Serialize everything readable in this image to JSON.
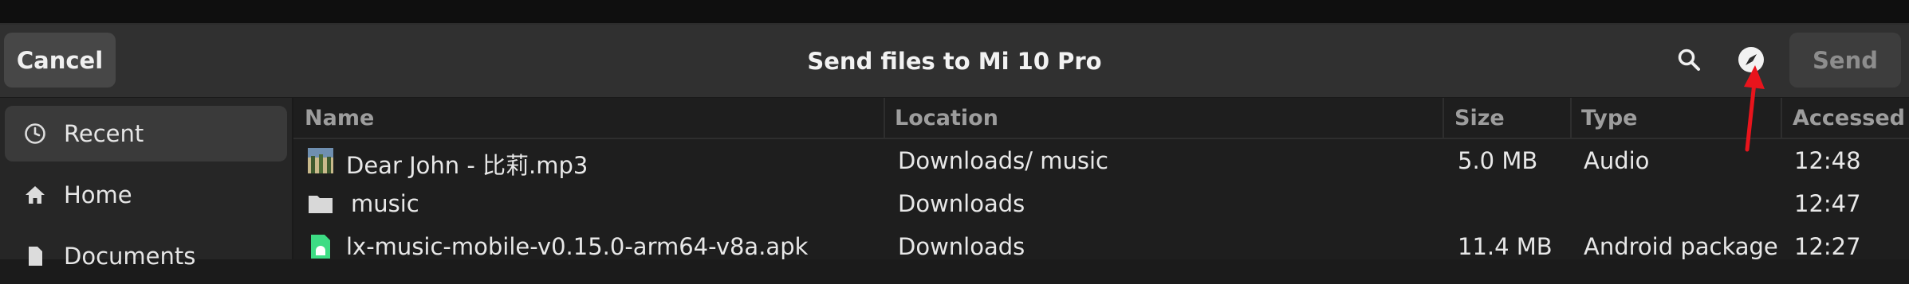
{
  "header": {
    "cancel_label": "Cancel",
    "title": "Send files to Mi 10 Pro",
    "send_label": "Send",
    "search_icon": "search-icon",
    "location_icon": "compass-icon",
    "annotation": "red-arrow"
  },
  "sidebar": {
    "items": [
      {
        "label": "Recent",
        "icon": "clock-icon"
      },
      {
        "label": "Home",
        "icon": "home-icon"
      },
      {
        "label": "Documents",
        "icon": "document-icon"
      }
    ]
  },
  "columns": [
    "Name",
    "Location",
    "Size",
    "Type",
    "Accessed"
  ],
  "files": [
    {
      "name": "Dear John - 比莉.mp3",
      "location": "Downloads/ music",
      "size": "5.0 MB",
      "type": "Audio",
      "accessed": "12:48",
      "icon": "album-art-icon"
    },
    {
      "name": "music",
      "location": "Downloads",
      "size": "",
      "type": "",
      "accessed": "12:47",
      "icon": "folder-icon"
    },
    {
      "name": "lx-music-mobile-v0.15.0-arm64-v8a.apk",
      "location": "Downloads",
      "size": "11.4 MB",
      "type": "Android package",
      "accessed": "12:27",
      "icon": "android-package-icon"
    }
  ],
  "colors": {
    "accent_annotation": "#e8141c",
    "header_bg": "#303030",
    "sidebar_bg": "#262626"
  }
}
